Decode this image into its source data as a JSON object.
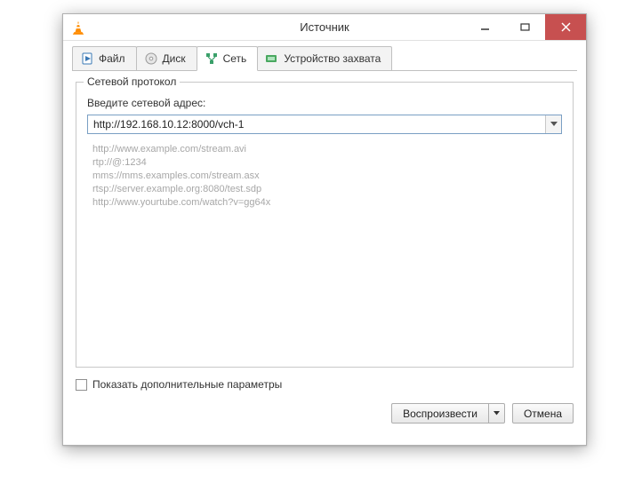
{
  "window": {
    "title": "Источник"
  },
  "tabs": {
    "file": "Файл",
    "disc": "Диск",
    "network": "Сеть",
    "capture": "Устройство захвата"
  },
  "network_panel": {
    "legend": "Сетевой протокол",
    "prompt": "Введите сетевой адрес:",
    "url_value": "http://192.168.10.12:8000/vch-1",
    "examples": [
      "http://www.example.com/stream.avi",
      "rtp://@:1234",
      "mms://mms.examples.com/stream.asx",
      "rtsp://server.example.org:8080/test.sdp",
      "http://www.yourtube.com/watch?v=gg64x"
    ]
  },
  "footer": {
    "show_more": "Показать дополнительные параметры",
    "play": "Воспроизвести",
    "cancel": "Отмена"
  }
}
